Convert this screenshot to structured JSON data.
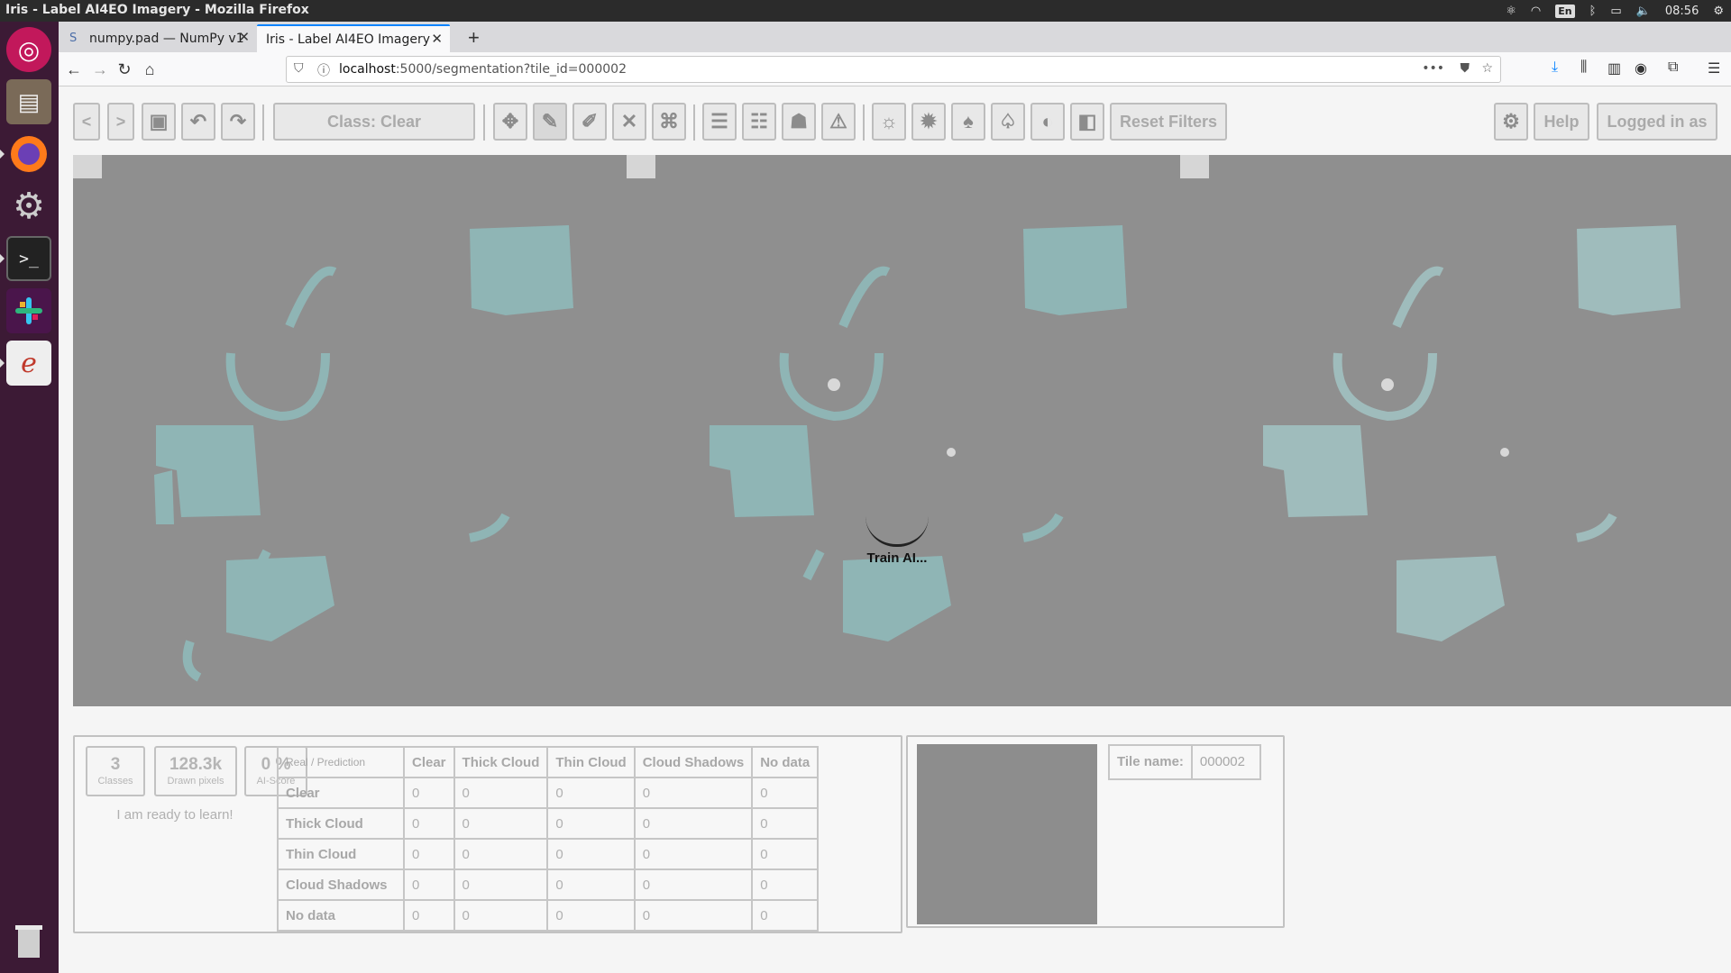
{
  "window": {
    "title": "Iris - Label AI4EO Imagery - Mozilla Firefox",
    "clock": "08:56",
    "lang": "En"
  },
  "tabs": [
    {
      "label": "numpy.pad — NumPy v1"
    },
    {
      "label": "Iris - Label AI4EO Imagery"
    }
  ],
  "url": {
    "host": "localhost",
    "path": ":5000/segmentation?tile_id=000002"
  },
  "toolbar": {
    "prev": "<",
    "next": ">",
    "class_label": "Class: Clear",
    "reset_filters": "Reset Filters",
    "help": "Help",
    "logged_in": "Logged in as"
  },
  "loader": {
    "text": "Train AI..."
  },
  "stats": {
    "classes": {
      "value": "3",
      "label": "Classes"
    },
    "drawn": {
      "value": "128.3k",
      "label": "Drawn pixels"
    },
    "ai": {
      "value": "0 %",
      "label": "AI-Score"
    },
    "ready": "I am ready to learn!"
  },
  "confusion": {
    "corner": "Real / Prediction",
    "columns": [
      "Clear",
      "Thick Cloud",
      "Thin Cloud",
      "Cloud Shadows",
      "No data"
    ],
    "rows": [
      {
        "label": "Clear",
        "values": [
          "0",
          "0",
          "0",
          "0",
          "0"
        ]
      },
      {
        "label": "Thick Cloud",
        "values": [
          "0",
          "0",
          "0",
          "0",
          "0"
        ]
      },
      {
        "label": "Thin Cloud",
        "values": [
          "0",
          "0",
          "0",
          "0",
          "0"
        ]
      },
      {
        "label": "Cloud Shadows",
        "values": [
          "0",
          "0",
          "0",
          "0",
          "0"
        ]
      },
      {
        "label": "No data",
        "values": [
          "0",
          "0",
          "0",
          "0",
          "0"
        ]
      }
    ]
  },
  "tile": {
    "label": "Tile name:",
    "value": "000002"
  },
  "colors": {
    "mask": "#8fb5b5",
    "view_bg": "#8f8f8f",
    "launcher": "#3c1a35",
    "accent": "#0a84ff"
  }
}
